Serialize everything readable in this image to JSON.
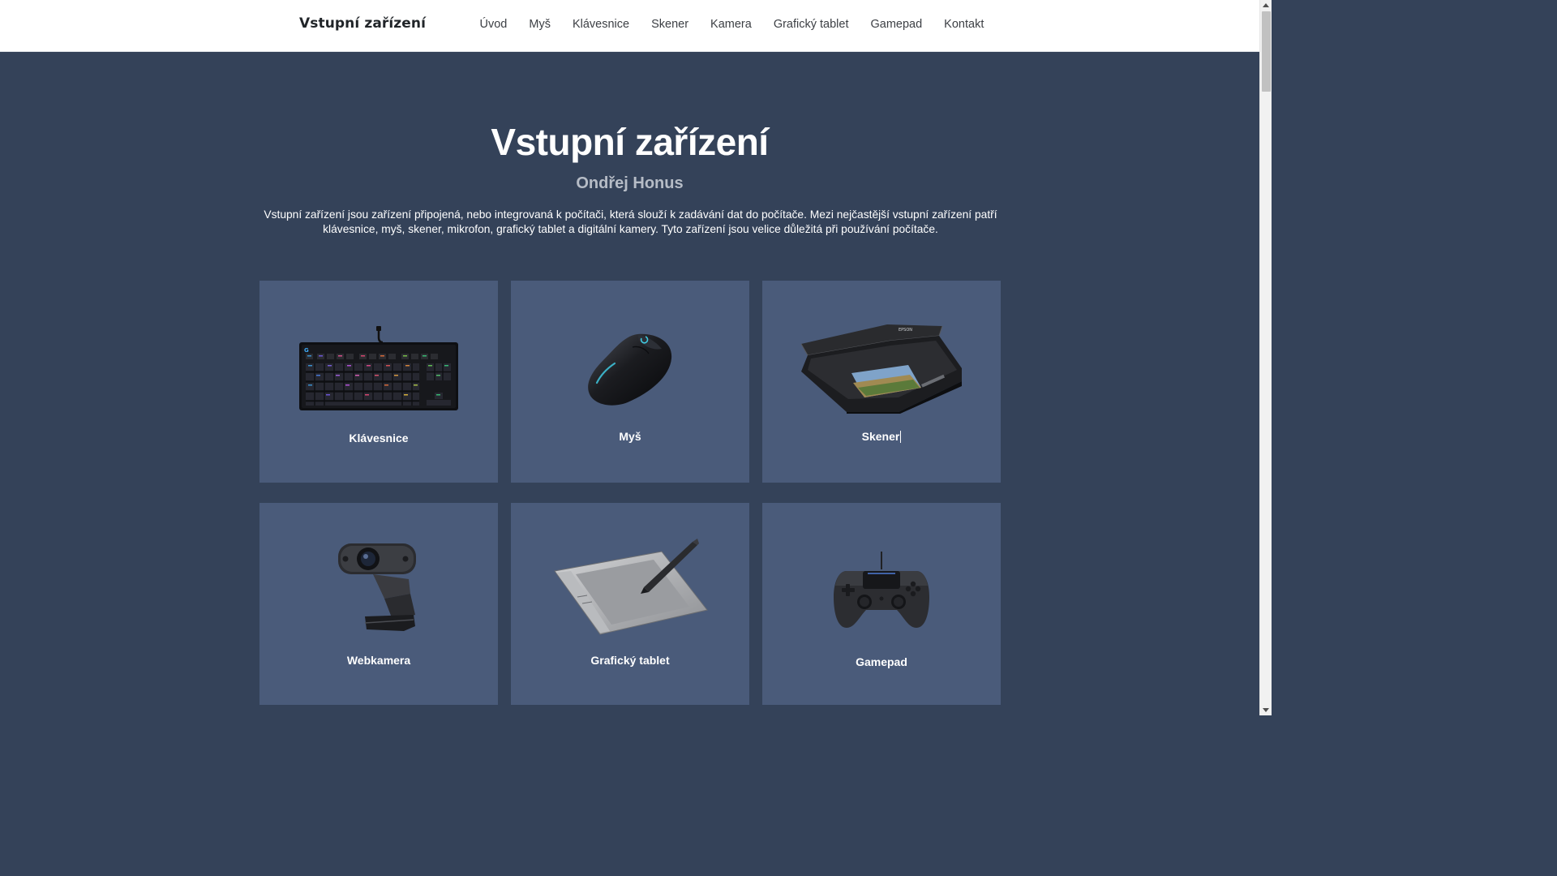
{
  "nav": {
    "brand": "Vstupní zařízení",
    "links": [
      "Úvod",
      "Myš",
      "Klávesnice",
      "Skener",
      "Kamera",
      "Grafický tablet",
      "Gamepad",
      "Kontakt"
    ]
  },
  "hero": {
    "title": "Vstupní zařízení",
    "author": "Ondřej Honus",
    "text": "Vstupní zařízení jsou zařízení připojená, nebo integrovaná k počítači, která slouží k zadávání dat do počítače. Mezi nejčastější vstupní zařízení patří klávesnice, myš, skener, mikrofon, grafický tablet a digitální kamery. Tyto zařízení jsou velice důležitá při používání počítače."
  },
  "cards": [
    {
      "label": "Klávesnice",
      "icon": "keyboard-icon"
    },
    {
      "label": "Myš",
      "icon": "mouse-icon"
    },
    {
      "label": "Skener",
      "icon": "scanner-icon"
    },
    {
      "label": "Webkamera",
      "icon": "webcam-icon"
    },
    {
      "label": "Grafický tablet",
      "icon": "tablet-icon"
    },
    {
      "label": "Gamepad",
      "icon": "gamepad-icon"
    }
  ],
  "colors": {
    "background": "#344259",
    "card": "#4a5b7a",
    "navbar": "#ffffff",
    "author": "#b6bcc6"
  }
}
